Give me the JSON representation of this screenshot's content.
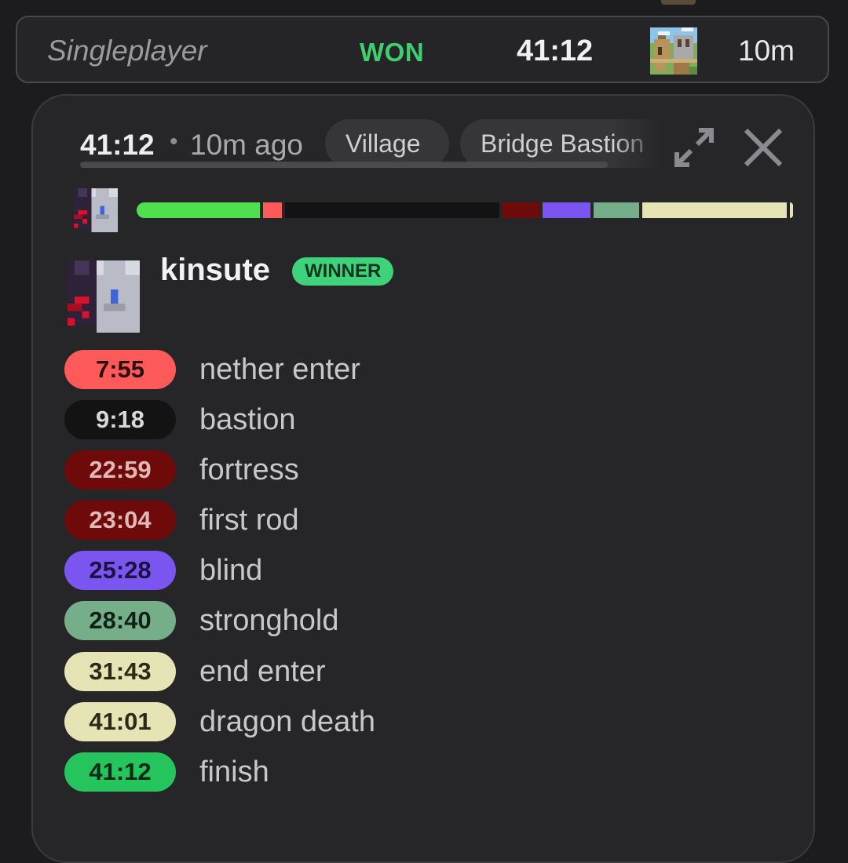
{
  "summary": {
    "mode": "Singleplayer",
    "result": "WON",
    "time": "41:12",
    "seed_icon": "village-thumbnail-icon",
    "ago": "10m"
  },
  "detail": {
    "time": "41:12",
    "separator": "•",
    "ago": "10m ago",
    "tags": [
      "Village",
      "Bridge Bastion"
    ],
    "expand_icon": "expand-arrows-icon",
    "close_icon": "close-icon"
  },
  "player": {
    "name": "kinsute",
    "badge": "WINNER",
    "avatar_icon": "pixel-cat-avatar-icon"
  },
  "splits": [
    {
      "time": "7:55",
      "label": "nether enter",
      "bg": "#ff5a5a",
      "fg": "#2a1010"
    },
    {
      "time": "9:18",
      "label": "bastion",
      "bg": "#131313",
      "fg": "#d8d8d8"
    },
    {
      "time": "22:59",
      "label": "fortress",
      "bg": "#6e0a0a",
      "fg": "#e0b8b8"
    },
    {
      "time": "23:04",
      "label": "first rod",
      "bg": "#6e0a0a",
      "fg": "#e0b8b8"
    },
    {
      "time": "25:28",
      "label": "blind",
      "bg": "#7a55f0",
      "fg": "#1a1240"
    },
    {
      "time": "28:40",
      "label": "stronghold",
      "bg": "#76ae8a",
      "fg": "#102218"
    },
    {
      "time": "31:43",
      "label": "end enter",
      "bg": "#e6e4b4",
      "fg": "#2a2a18"
    },
    {
      "time": "41:01",
      "label": "dragon death",
      "bg": "#e6e4b4",
      "fg": "#2a2a18"
    },
    {
      "time": "41:12",
      "label": "finish",
      "bg": "#25c45c",
      "fg": "#0c2a16"
    }
  ],
  "timeline": {
    "total": "41:12",
    "segments": [
      {
        "from": "0:00",
        "to": "7:55",
        "color": "#4fe04f"
      },
      {
        "from": "7:55",
        "to": "9:18",
        "color": "#ff5a5a"
      },
      {
        "from": "9:18",
        "to": "22:59",
        "color": "#131313"
      },
      {
        "from": "22:59",
        "to": "23:04",
        "color": "#6e0a0a"
      },
      {
        "from": "23:04",
        "to": "25:28",
        "color": "#6e0a0a"
      },
      {
        "from": "25:28",
        "to": "28:40",
        "color": "#7a55f0"
      },
      {
        "from": "28:40",
        "to": "31:43",
        "color": "#76ae8a"
      },
      {
        "from": "31:43",
        "to": "41:01",
        "color": "#e6e4b4"
      },
      {
        "from": "41:01",
        "to": "41:12",
        "color": "#e6e4b4"
      }
    ]
  },
  "colors": {
    "won": "#3ecf6e",
    "winner_badge": "#3ed27a"
  }
}
